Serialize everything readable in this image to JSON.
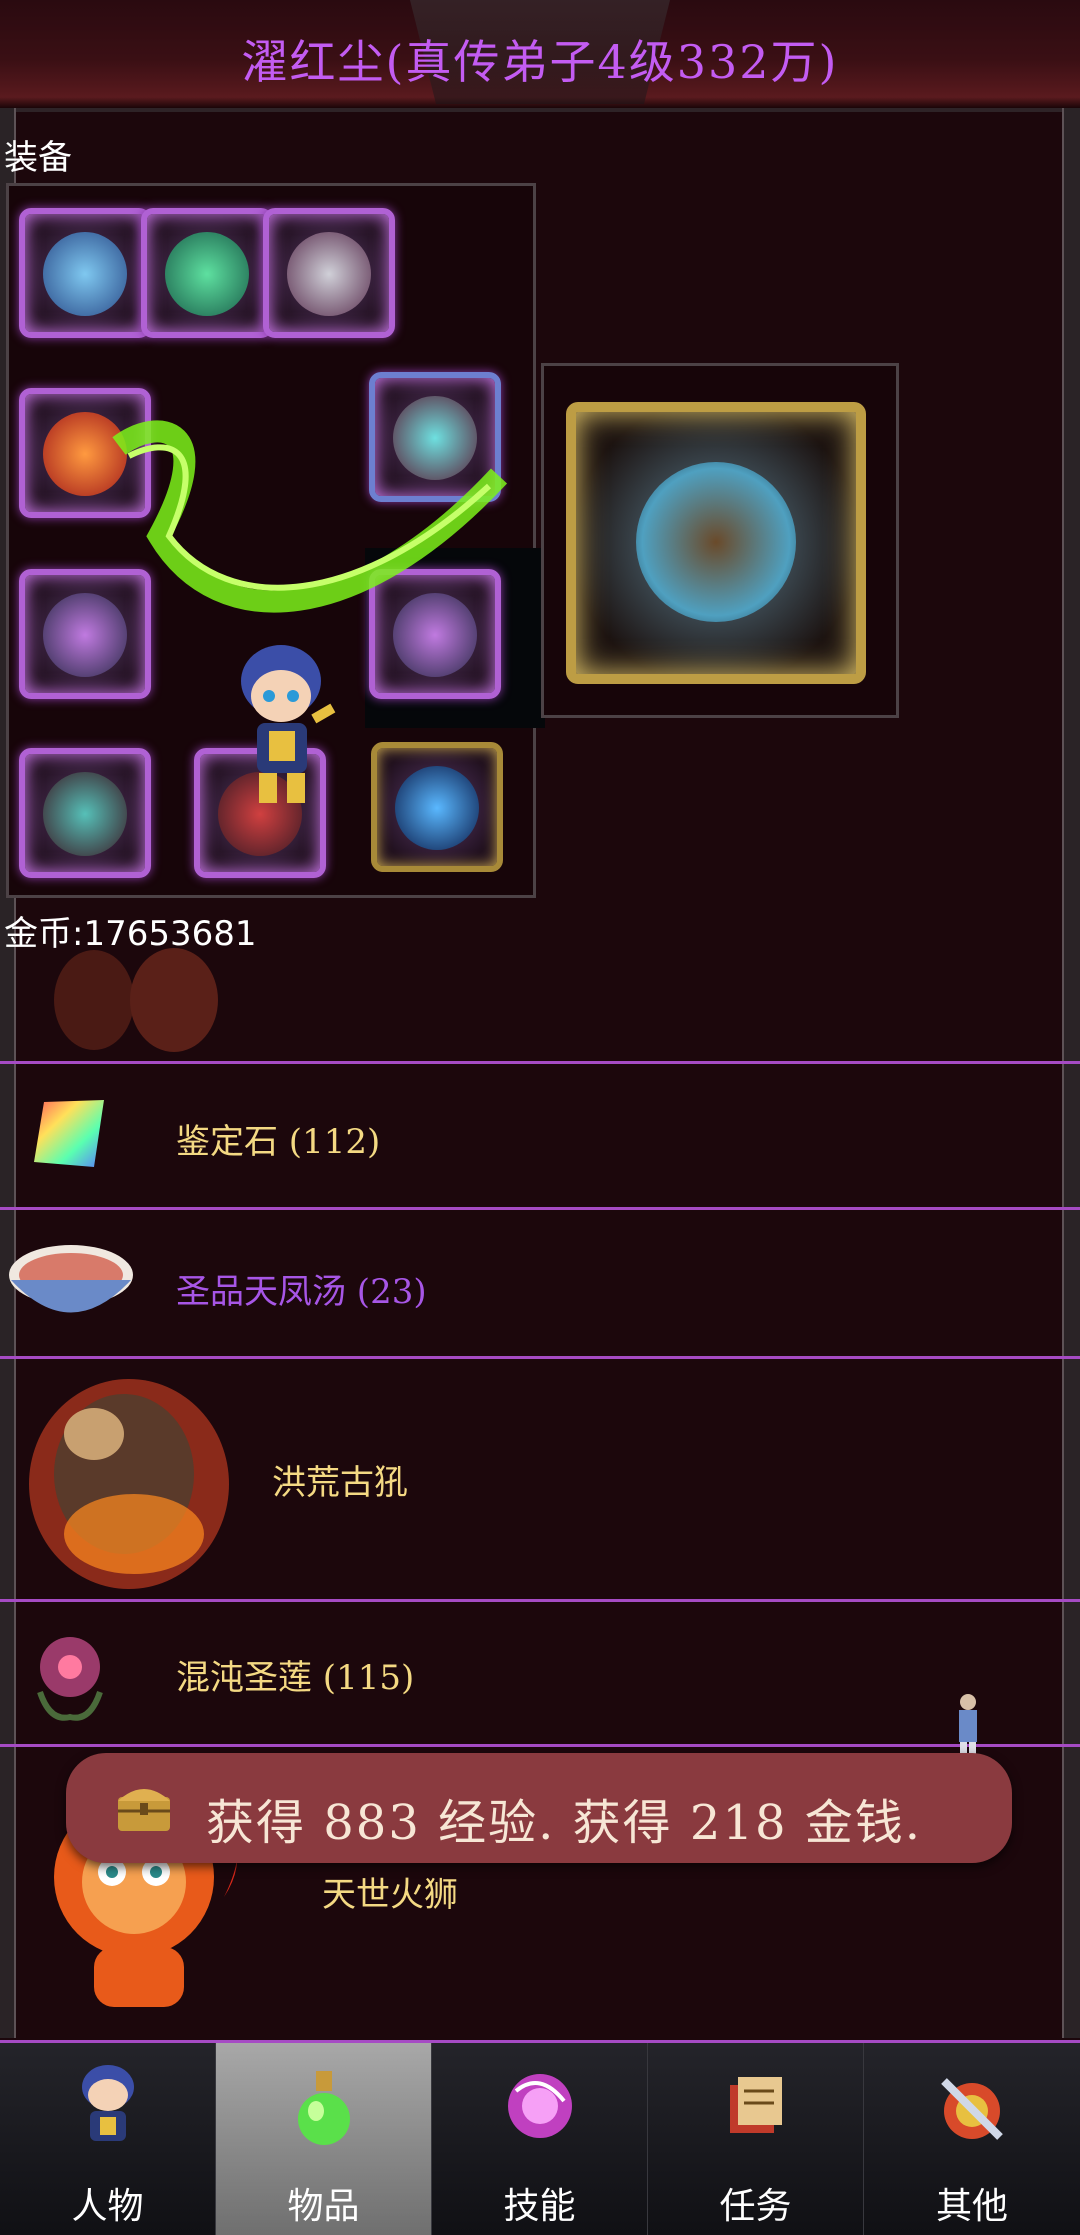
{
  "header": {
    "title": "濯红尘(真传弟子4级332万)"
  },
  "equipment": {
    "label": "装备",
    "slots": [
      "weapon-a",
      "armor",
      "helmet",
      "fire-blade",
      "bow",
      "ring-left",
      "ring-right",
      "amulet",
      "boots",
      "orb"
    ],
    "detail_item": "boat"
  },
  "wallet": {
    "coins_text": "金币:17653681"
  },
  "inventory": {
    "items": [
      {
        "name": "鉴定石 (112)",
        "icon": "rainbow-gem-icon",
        "color": "#f4d983"
      },
      {
        "name": "圣品天凤汤 (23)",
        "icon": "soup-bowl-icon",
        "color": "#a756e6"
      },
      {
        "name": "洪荒古犼",
        "icon": "beast-icon",
        "color": "#f4d983"
      },
      {
        "name": "混沌圣莲 (115)",
        "icon": "lotus-icon",
        "color": "#f4d983"
      },
      {
        "name": "天世火狮",
        "icon": "fire-lion-icon",
        "color": "#f4d983"
      }
    ]
  },
  "toast": {
    "message": "获得 883 经验. 获得 218 金钱."
  },
  "tabs": [
    {
      "label": "人物",
      "icon": "character-icon",
      "active": false
    },
    {
      "label": "物品",
      "icon": "potion-icon",
      "active": true
    },
    {
      "label": "技能",
      "icon": "skill-orb-icon",
      "active": false
    },
    {
      "label": "任务",
      "icon": "quest-scroll-icon",
      "active": false
    },
    {
      "label": "其他",
      "icon": "sword-shield-icon",
      "active": false
    }
  ],
  "colors": {
    "accent_purple": "#a64bc4",
    "title_purple": "#c35cf2",
    "item_yellow": "#f4d983"
  }
}
